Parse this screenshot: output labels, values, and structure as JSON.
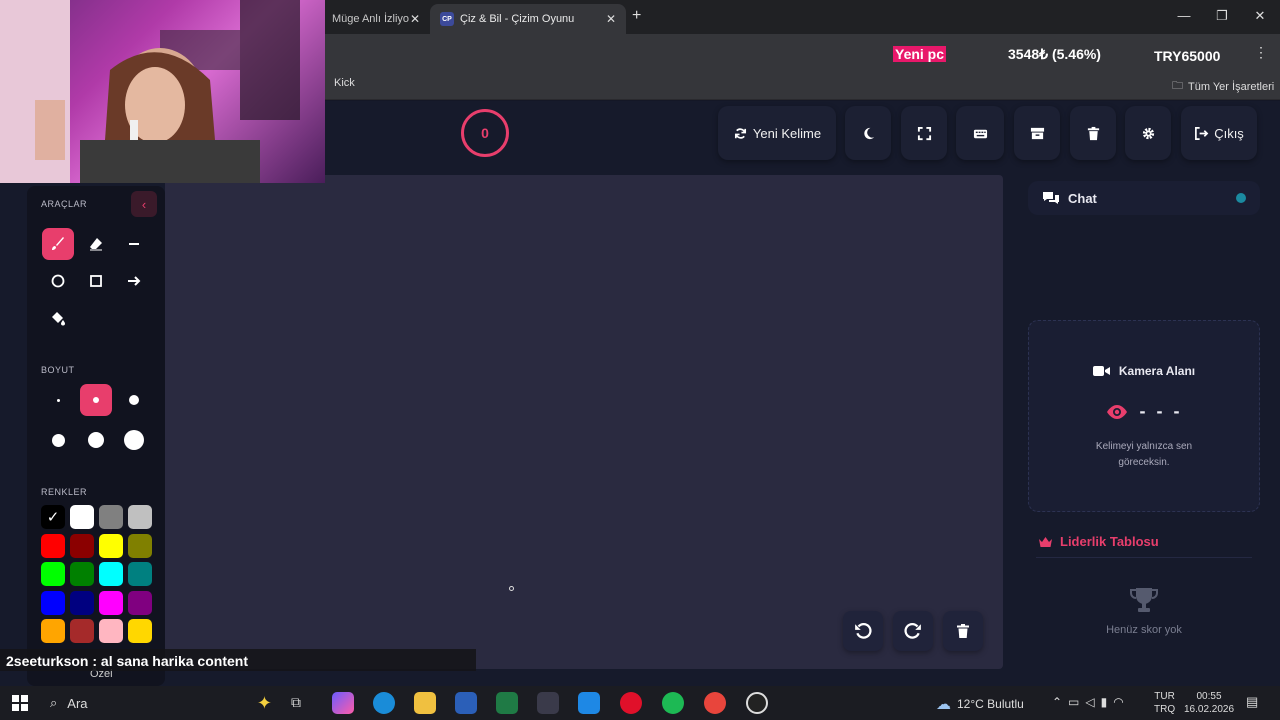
{
  "browser": {
    "tabs": [
      {
        "title": "Müge Anlı İzliyo",
        "active": false
      },
      {
        "title": "Çiz & Bil - Çizim Oyunu",
        "active": true,
        "favicon": "CP"
      }
    ],
    "bookmarks": {
      "left": "Kick",
      "right": "Tüm Yer İşaretleri"
    }
  },
  "ticker": {
    "label": "Yeni pc",
    "amount": "3548₺ (5.46%)",
    "goal": "TRY65000"
  },
  "game": {
    "score": "0",
    "buttons": {
      "new_word": "Yeni Kelime",
      "exit": "Çıkış"
    }
  },
  "tools_panel": {
    "tools_label": "ARAÇLAR",
    "size_label": "BOYUT",
    "colors_label": "RENKLER",
    "custom_label": "Özel",
    "colors": [
      "#000000",
      "#ffffff",
      "#808080",
      "#c0c0c0",
      "#ff0000",
      "#8b0000",
      "#ffff00",
      "#808000",
      "#00ff00",
      "#008000",
      "#00ffff",
      "#008080",
      "#0000ff",
      "#000080",
      "#ff00ff",
      "#800080",
      "#ffa500",
      "#a52a2a",
      "#ffb6c1",
      "#ffd700"
    ]
  },
  "chat": {
    "title": "Chat"
  },
  "camera": {
    "title": "Kamera Alanı",
    "word_placeholder": "- - -",
    "hint": "Kelimeyi yalnızca sen göreceksin."
  },
  "leaderboard": {
    "title": "Liderlik Tablosu",
    "empty": "Henüz skor yok"
  },
  "stream_chat": {
    "user": "2seeturkson",
    "message": " : al sana harika content"
  },
  "taskbar": {
    "search": "Ara",
    "weather": "12°C Bulutlu",
    "lang": "TUR",
    "lang2": "TRQ",
    "time": "00:55",
    "date": "16.02.2026"
  },
  "colors": {
    "accent": "#e83e6c",
    "panel": "#11131f",
    "canvas": "#2a2a40"
  }
}
